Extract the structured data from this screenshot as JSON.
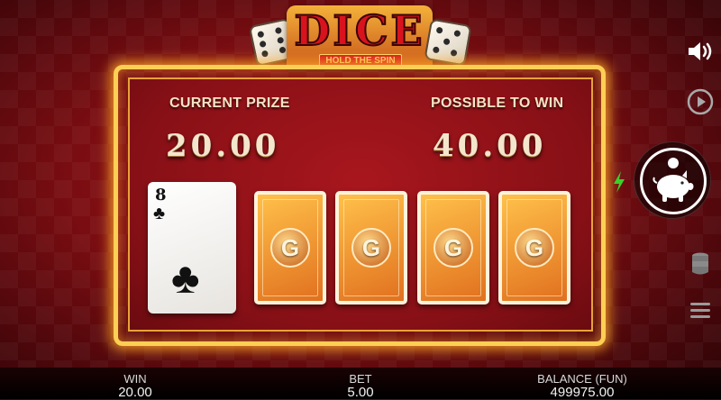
{
  "logo": {
    "title": "DICE",
    "subtitle": "HOLD THE SPIN"
  },
  "prize": {
    "current_label": "CURRENT PRIZE",
    "current_value": "20.00",
    "possible_label": "POSSIBLE TO WIN",
    "possible_value": "40.00"
  },
  "cards": {
    "revealed": {
      "rank": "8",
      "suit": "♣"
    },
    "hidden": [
      {
        "emblem": "G"
      },
      {
        "emblem": "G"
      },
      {
        "emblem": "G"
      },
      {
        "emblem": "G"
      }
    ]
  },
  "controls": {
    "icons": [
      "sound-icon",
      "replay-icon",
      "piggy-bank-icon",
      "lightning-icon",
      "coins-stack-icon",
      "menu-icon"
    ]
  },
  "footer": {
    "win_label": "WIN",
    "win_value": "20.00",
    "bet_label": "BET",
    "bet_value": "5.00",
    "balance_label": "BALANCE (FUN)",
    "balance_value": "499975.00"
  },
  "colors": {
    "frame_gold": "#ffcf55",
    "background_red": "#8a0f15",
    "card_back_orange": "#f0962f"
  }
}
